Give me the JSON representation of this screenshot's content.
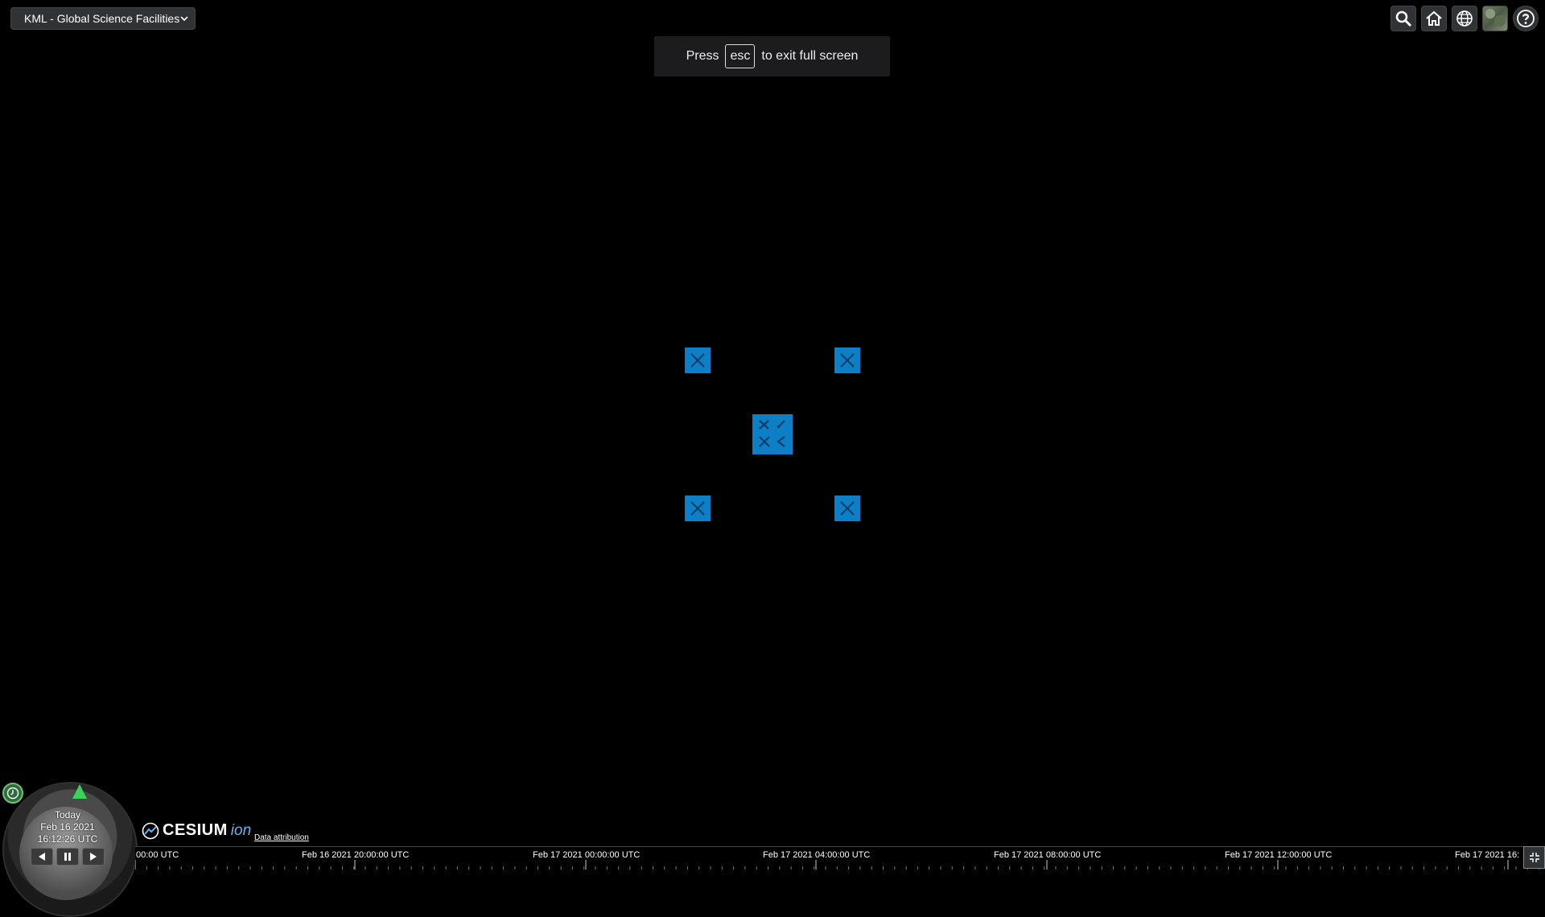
{
  "demo_select": {
    "selected": "KML - Global Science Facilities"
  },
  "toolbar": {
    "icons": [
      "search-icon",
      "home-icon",
      "globe-icon",
      "imagery-icon",
      "help-icon"
    ]
  },
  "fullscreen_notice": {
    "press": "Press",
    "key": "esc",
    "suffix": "to exit full screen"
  },
  "animation": {
    "line1": "Today",
    "line2": "Feb 16 2021",
    "line3": "16:12:26 UTC"
  },
  "logo": {
    "word": "CESIUM",
    "ion": "ion"
  },
  "attribution": "Data attribution",
  "timeline": {
    "labels": [
      "00:00 UTC",
      "Feb 16 2021 20:00:00 UTC",
      "Feb 17 2021 00:00:00 UTC",
      "Feb 17 2021 04:00:00 UTC",
      "Feb 17 2021 08:00:00 UTC",
      "Feb 17 2021 12:00:00 UTC",
      "Feb 17 2021 16:"
    ]
  },
  "colors": {
    "placeholder_blue": "#0d7fc6",
    "background": "#000000",
    "needle": "#3bd15a"
  }
}
